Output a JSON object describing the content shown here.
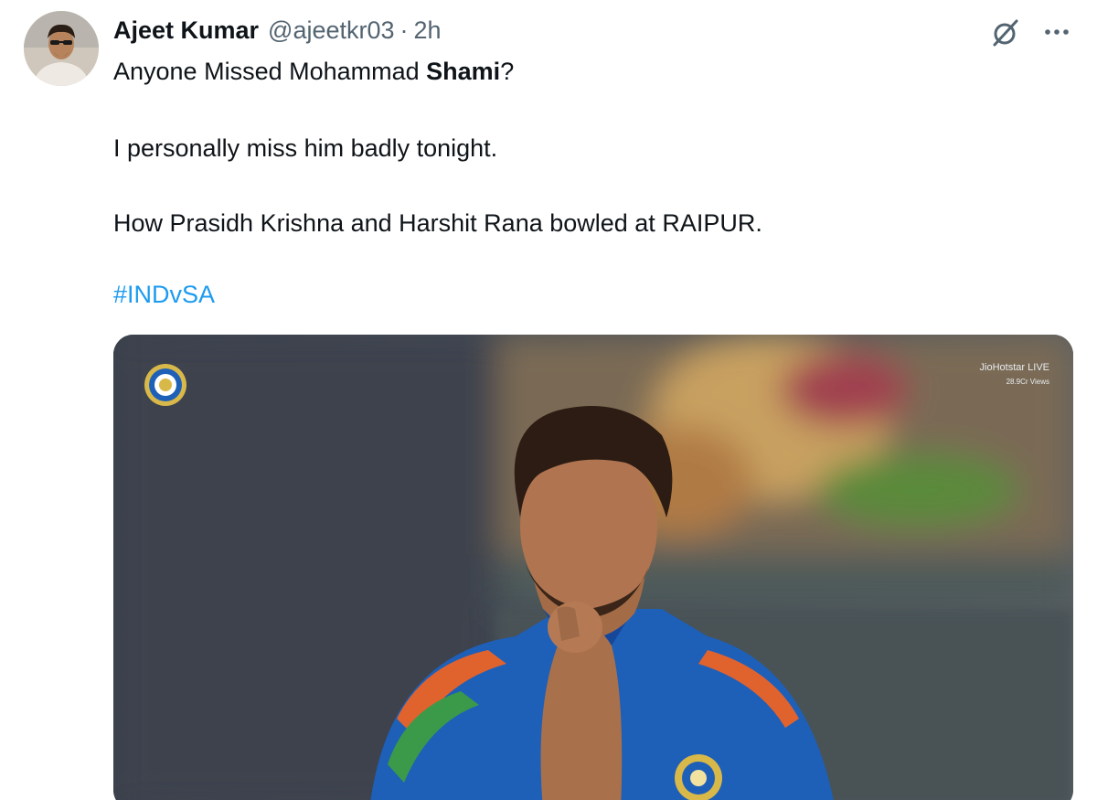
{
  "author": {
    "display_name": "Ajeet Kumar",
    "handle": "@ajeetkr03",
    "separator": "·",
    "timestamp": "2h"
  },
  "icons": {
    "grok": "grok-icon",
    "more": "more-options-icon"
  },
  "tweet": {
    "line1_prefix": "Anyone Missed  Mohammad ",
    "line1_bold": "Shami",
    "line1_suffix": "?",
    "line2": "I personally miss him badly tonight.",
    "line3": "How Prasidh Krishna and Harshit Rana bowled at RAIPUR.",
    "hashtag": "#INDvSA"
  },
  "media": {
    "watermark_brand": "JioHotstar",
    "watermark_badge": "LIVE",
    "watermark_views": "28.9Cr Views"
  },
  "colors": {
    "link": "#1d9bf0",
    "secondary_text": "#536471",
    "primary_text": "#0f1419",
    "jersey_blue": "#1e5fb8"
  }
}
